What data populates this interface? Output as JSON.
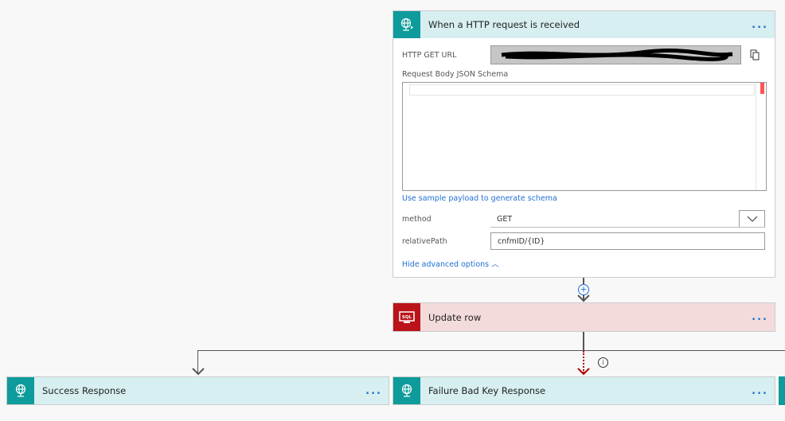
{
  "trigger": {
    "title": "When a HTTP request is received",
    "url_label": "HTTP GET URL",
    "url_value": "",
    "schema_label": "Request Body JSON Schema",
    "sample_link": "Use sample payload to generate schema",
    "method_label": "method",
    "method_value": "GET",
    "path_label": "relativePath",
    "path_value": "cnfmID/{ID}",
    "hide_advanced": "Hide advanced options",
    "icon": "globe-request-icon"
  },
  "update": {
    "title": "Update row",
    "icon": "sql-icon"
  },
  "success": {
    "title": "Success Response",
    "icon": "globe-response-icon"
  },
  "failure": {
    "title": "Failure Bad Key Response",
    "icon": "globe-response-icon"
  },
  "more_label": "...",
  "colors": {
    "teal": "#0e9b9b",
    "teal_header": "#d7eff1",
    "sql_red": "#ba141a",
    "sql_header": "#f3dbdb",
    "link": "#1f6fd1",
    "failure_arrow": "#b00000"
  }
}
